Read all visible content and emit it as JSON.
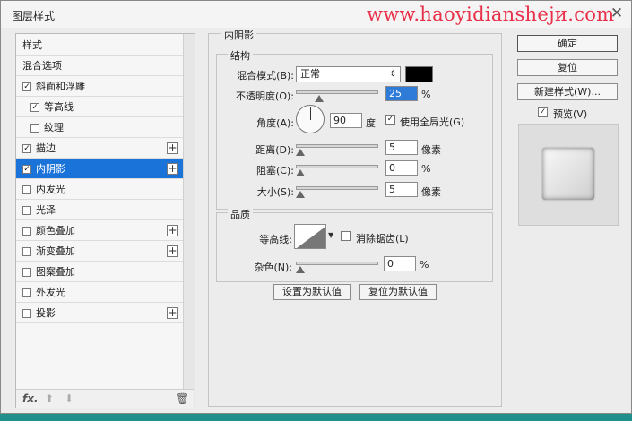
{
  "window": {
    "title": "图层样式",
    "watermark": "www.haoyidianshejи.com"
  },
  "sidebar": {
    "items": [
      {
        "label": "样式",
        "checkbox": false,
        "checked": false,
        "indent": false,
        "plus": false,
        "active": false
      },
      {
        "label": "混合选项",
        "checkbox": false,
        "checked": false,
        "indent": false,
        "plus": false,
        "active": false
      },
      {
        "label": "斜面和浮雕",
        "checkbox": true,
        "checked": true,
        "indent": false,
        "plus": false,
        "active": false
      },
      {
        "label": "等高线",
        "checkbox": true,
        "checked": true,
        "indent": true,
        "plus": false,
        "active": false
      },
      {
        "label": "纹理",
        "checkbox": true,
        "checked": false,
        "indent": true,
        "plus": false,
        "active": false
      },
      {
        "label": "描边",
        "checkbox": true,
        "checked": true,
        "indent": false,
        "plus": true,
        "active": false
      },
      {
        "label": "内阴影",
        "checkbox": true,
        "checked": true,
        "indent": false,
        "plus": true,
        "active": true
      },
      {
        "label": "内发光",
        "checkbox": true,
        "checked": false,
        "indent": false,
        "plus": false,
        "active": false
      },
      {
        "label": "光泽",
        "checkbox": true,
        "checked": false,
        "indent": false,
        "plus": false,
        "active": false
      },
      {
        "label": "颜色叠加",
        "checkbox": true,
        "checked": false,
        "indent": false,
        "plus": true,
        "active": false
      },
      {
        "label": "渐变叠加",
        "checkbox": true,
        "checked": false,
        "indent": false,
        "plus": true,
        "active": false
      },
      {
        "label": "图案叠加",
        "checkbox": true,
        "checked": false,
        "indent": false,
        "plus": false,
        "active": false
      },
      {
        "label": "外发光",
        "checkbox": true,
        "checked": false,
        "indent": false,
        "plus": false,
        "active": false
      },
      {
        "label": "投影",
        "checkbox": true,
        "checked": false,
        "indent": false,
        "plus": true,
        "active": false
      }
    ],
    "footer": {
      "fx": "fx."
    }
  },
  "panel": {
    "section_title": "内阴影",
    "structure": {
      "title": "结构",
      "blend_mode_label": "混合模式(B):",
      "blend_mode_value": "正常",
      "shadow_color": "#000000",
      "opacity_label": "不透明度(O):",
      "opacity_value": "25",
      "opacity_unit": "%",
      "angle_label": "角度(A):",
      "angle_value": "90",
      "angle_unit": "度",
      "global_light_label": "使用全局光(G)",
      "global_light_checked": true,
      "distance_label": "距离(D):",
      "distance_value": "5",
      "distance_unit": "像素",
      "choke_label": "阻塞(C):",
      "choke_value": "0",
      "choke_unit": "%",
      "size_label": "大小(S):",
      "size_value": "5",
      "size_unit": "像素"
    },
    "quality": {
      "title": "品质",
      "contour_label": "等高线:",
      "antialias_label": "消除锯齿(L)",
      "antialias_checked": false,
      "noise_label": "杂色(N):",
      "noise_value": "0",
      "noise_unit": "%"
    },
    "set_default_label": "设置为默认值",
    "reset_default_label": "复位为默认值"
  },
  "right": {
    "ok_label": "确定",
    "reset_label": "复位",
    "new_style_label": "新建样式(W)...",
    "preview_label": "预览(V)",
    "preview_checked": true
  }
}
